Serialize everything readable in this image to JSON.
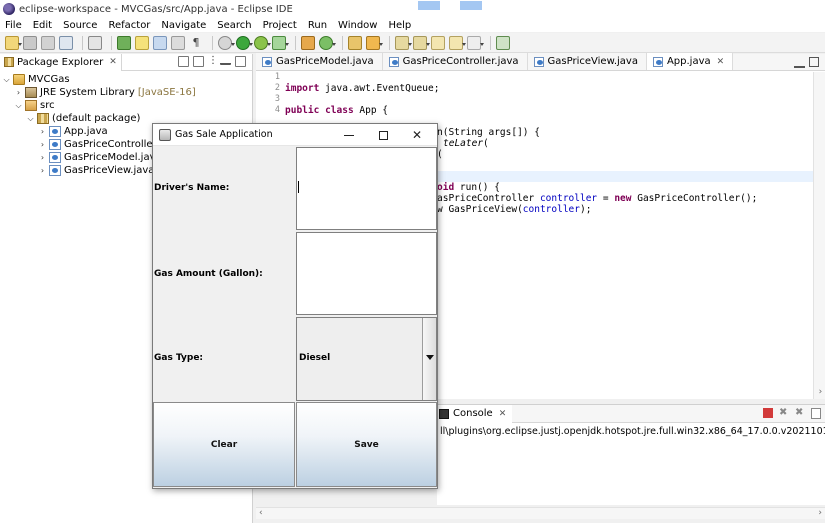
{
  "window": {
    "title": "eclipse-workspace - MVCGas/src/App.java - Eclipse IDE"
  },
  "menu": [
    "File",
    "Edit",
    "Source",
    "Refactor",
    "Navigate",
    "Search",
    "Project",
    "Run",
    "Window",
    "Help"
  ],
  "package_explorer": {
    "tab_label": "Package Explorer",
    "tree": {
      "project": "MVCGas",
      "jre_label": "JRE System Library",
      "jre_version": "[JavaSE-16]",
      "src_label": "src",
      "package_label": "(default package)",
      "files": [
        "App.java",
        "GasPriceController.java",
        "GasPriceModel.java",
        "GasPriceView.java"
      ]
    }
  },
  "editor": {
    "tabs": [
      "GasPriceModel.java",
      "GasPriceController.java",
      "GasPriceView.java",
      "App.java"
    ],
    "active_tab": "App.java",
    "line_numbers": [
      "1",
      "2",
      "3",
      "4"
    ],
    "code": {
      "l2_kw": "import",
      "l2_rest": " java.awt.EventQueue;",
      "l4_kw1": "public",
      "l4_kw2": "class",
      "l4_rest": " App {",
      "l6_rest": "n(String args[]) {",
      "l7_it": "teLater",
      "l7_rest": "(",
      "l8_rest": "(",
      "l10_kw": "oid",
      "l10_rest": " run() {",
      "l11_a": "asPriceController ",
      "l11_var": "controller",
      "l11_b": " = ",
      "l11_kw": "new",
      "l11_c": " GasPriceController();",
      "l12_a": "w GasPriceView(",
      "l12_var": "controller",
      "l12_b": ");"
    }
  },
  "console": {
    "tab_label": "Console",
    "text": "ll\\plugins\\org.eclipse.justj.openjdk.hotspot.jre.full.win32.x86_64_17.0.0.v20211012-1059\\jre\\bin\\javaw"
  },
  "dialog": {
    "title": "Gas Sale Application",
    "driver_label": "Driver's Name:",
    "amount_label": "Gas Amount (Gallon):",
    "type_label": "Gas Type:",
    "type_value": "Diesel",
    "clear_label": "Clear",
    "save_label": "Save"
  }
}
